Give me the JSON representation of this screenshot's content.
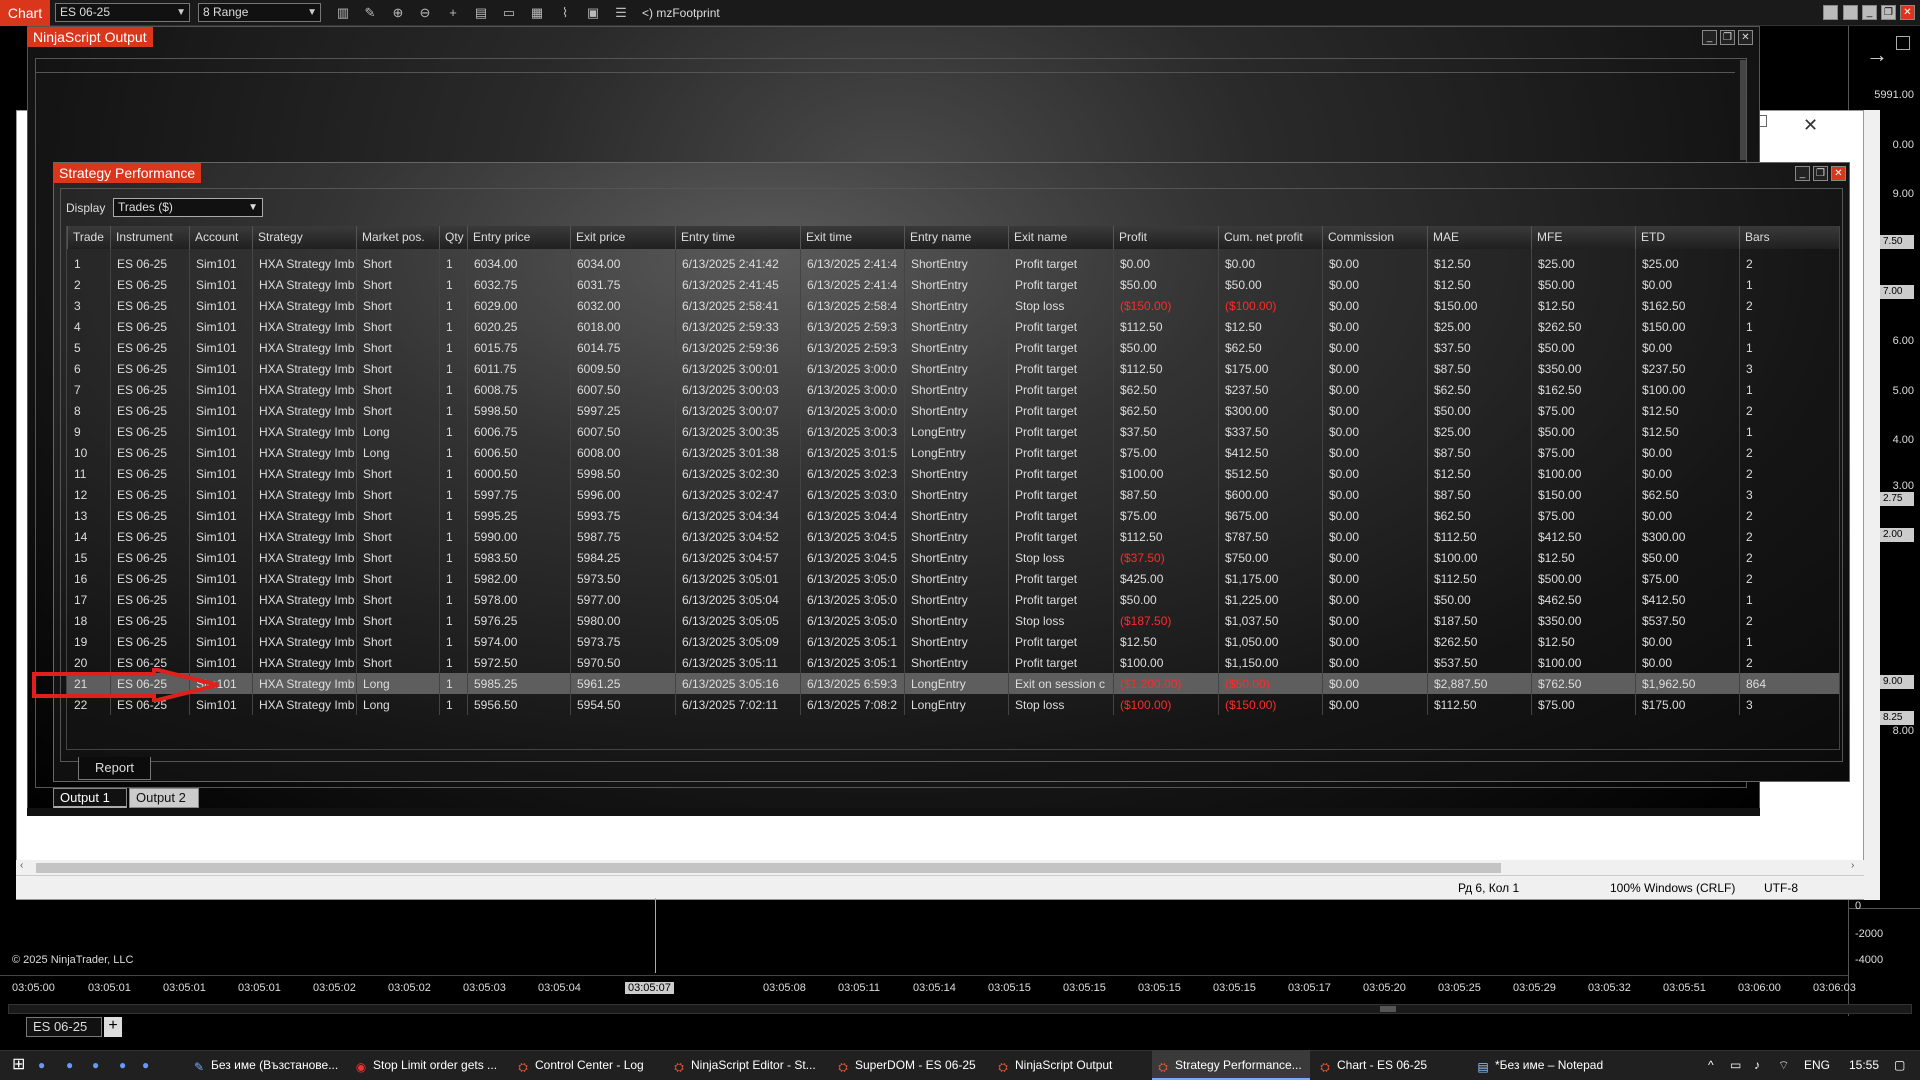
{
  "toolbar": {
    "chart_tab": "Chart",
    "instrument": "ES 06-25",
    "bar_type": "8 Range",
    "indicator_label": "mzFootprint"
  },
  "nso": {
    "title": "NinjaScript Output",
    "tabs": [
      "Output 1",
      "Output 2"
    ]
  },
  "sp": {
    "title": "Strategy Performance",
    "display_label": "Display",
    "display_value": "Trades ($)",
    "report_tab": "Report",
    "columns": [
      "Trade",
      "Instrument",
      "Account",
      "Strategy",
      "Market pos.",
      "Qty",
      "Entry price",
      "Exit price",
      "Entry time",
      "Exit time",
      "Entry name",
      "Exit name",
      "Profit",
      "Cum. net profit",
      "Commission",
      "MAE",
      "MFE",
      "ETD",
      "Bars"
    ],
    "rows": [
      [
        "1",
        "ES 06-25",
        "Sim101",
        "HXA Strategy Imb",
        "Short",
        "1",
        "6034.00",
        "6034.00",
        "6/13/2025 2:41:42",
        "6/13/2025 2:41:4",
        "ShortEntry",
        "Profit target",
        "$0.00",
        "$0.00",
        "$0.00",
        "$12.50",
        "$25.00",
        "$25.00",
        "2"
      ],
      [
        "2",
        "ES 06-25",
        "Sim101",
        "HXA Strategy Imb",
        "Short",
        "1",
        "6032.75",
        "6031.75",
        "6/13/2025 2:41:45",
        "6/13/2025 2:41:4",
        "ShortEntry",
        "Profit target",
        "$50.00",
        "$50.00",
        "$0.00",
        "$12.50",
        "$50.00",
        "$0.00",
        "1"
      ],
      [
        "3",
        "ES 06-25",
        "Sim101",
        "HXA Strategy Imb",
        "Short",
        "1",
        "6029.00",
        "6032.00",
        "6/13/2025 2:58:41",
        "6/13/2025 2:58:4",
        "ShortEntry",
        "Stop loss",
        "($150.00)",
        "($100.00)",
        "$0.00",
        "$150.00",
        "$12.50",
        "$162.50",
        "2"
      ],
      [
        "4",
        "ES 06-25",
        "Sim101",
        "HXA Strategy Imb",
        "Short",
        "1",
        "6020.25",
        "6018.00",
        "6/13/2025 2:59:33",
        "6/13/2025 2:59:3",
        "ShortEntry",
        "Profit target",
        "$112.50",
        "$12.50",
        "$0.00",
        "$25.00",
        "$262.50",
        "$150.00",
        "1"
      ],
      [
        "5",
        "ES 06-25",
        "Sim101",
        "HXA Strategy Imb",
        "Short",
        "1",
        "6015.75",
        "6014.75",
        "6/13/2025 2:59:36",
        "6/13/2025 2:59:3",
        "ShortEntry",
        "Profit target",
        "$50.00",
        "$62.50",
        "$0.00",
        "$37.50",
        "$50.00",
        "$0.00",
        "1"
      ],
      [
        "6",
        "ES 06-25",
        "Sim101",
        "HXA Strategy Imb",
        "Short",
        "1",
        "6011.75",
        "6009.50",
        "6/13/2025 3:00:01",
        "6/13/2025 3:00:0",
        "ShortEntry",
        "Profit target",
        "$112.50",
        "$175.00",
        "$0.00",
        "$87.50",
        "$350.00",
        "$237.50",
        "3"
      ],
      [
        "7",
        "ES 06-25",
        "Sim101",
        "HXA Strategy Imb",
        "Short",
        "1",
        "6008.75",
        "6007.50",
        "6/13/2025 3:00:03",
        "6/13/2025 3:00:0",
        "ShortEntry",
        "Profit target",
        "$62.50",
        "$237.50",
        "$0.00",
        "$62.50",
        "$162.50",
        "$100.00",
        "1"
      ],
      [
        "8",
        "ES 06-25",
        "Sim101",
        "HXA Strategy Imb",
        "Short",
        "1",
        "5998.50",
        "5997.25",
        "6/13/2025 3:00:07",
        "6/13/2025 3:00:0",
        "ShortEntry",
        "Profit target",
        "$62.50",
        "$300.00",
        "$0.00",
        "$50.00",
        "$75.00",
        "$12.50",
        "2"
      ],
      [
        "9",
        "ES 06-25",
        "Sim101",
        "HXA Strategy Imb",
        "Long",
        "1",
        "6006.75",
        "6007.50",
        "6/13/2025 3:00:35",
        "6/13/2025 3:00:3",
        "LongEntry",
        "Profit target",
        "$37.50",
        "$337.50",
        "$0.00",
        "$25.00",
        "$50.00",
        "$12.50",
        "1"
      ],
      [
        "10",
        "ES 06-25",
        "Sim101",
        "HXA Strategy Imb",
        "Long",
        "1",
        "6006.50",
        "6008.00",
        "6/13/2025 3:01:38",
        "6/13/2025 3:01:5",
        "LongEntry",
        "Profit target",
        "$75.00",
        "$412.50",
        "$0.00",
        "$87.50",
        "$75.00",
        "$0.00",
        "2"
      ],
      [
        "11",
        "ES 06-25",
        "Sim101",
        "HXA Strategy Imb",
        "Short",
        "1",
        "6000.50",
        "5998.50",
        "6/13/2025 3:02:30",
        "6/13/2025 3:02:3",
        "ShortEntry",
        "Profit target",
        "$100.00",
        "$512.50",
        "$0.00",
        "$12.50",
        "$100.00",
        "$0.00",
        "2"
      ],
      [
        "12",
        "ES 06-25",
        "Sim101",
        "HXA Strategy Imb",
        "Short",
        "1",
        "5997.75",
        "5996.00",
        "6/13/2025 3:02:47",
        "6/13/2025 3:03:0",
        "ShortEntry",
        "Profit target",
        "$87.50",
        "$600.00",
        "$0.00",
        "$87.50",
        "$150.00",
        "$62.50",
        "3"
      ],
      [
        "13",
        "ES 06-25",
        "Sim101",
        "HXA Strategy Imb",
        "Short",
        "1",
        "5995.25",
        "5993.75",
        "6/13/2025 3:04:34",
        "6/13/2025 3:04:4",
        "ShortEntry",
        "Profit target",
        "$75.00",
        "$675.00",
        "$0.00",
        "$62.50",
        "$75.00",
        "$0.00",
        "2"
      ],
      [
        "14",
        "ES 06-25",
        "Sim101",
        "HXA Strategy Imb",
        "Short",
        "1",
        "5990.00",
        "5987.75",
        "6/13/2025 3:04:52",
        "6/13/2025 3:04:5",
        "ShortEntry",
        "Profit target",
        "$112.50",
        "$787.50",
        "$0.00",
        "$112.50",
        "$412.50",
        "$300.00",
        "2"
      ],
      [
        "15",
        "ES 06-25",
        "Sim101",
        "HXA Strategy Imb",
        "Short",
        "1",
        "5983.50",
        "5984.25",
        "6/13/2025 3:04:57",
        "6/13/2025 3:04:5",
        "ShortEntry",
        "Stop loss",
        "($37.50)",
        "$750.00",
        "$0.00",
        "$100.00",
        "$12.50",
        "$50.00",
        "2"
      ],
      [
        "16",
        "ES 06-25",
        "Sim101",
        "HXA Strategy Imb",
        "Short",
        "1",
        "5982.00",
        "5973.50",
        "6/13/2025 3:05:01",
        "6/13/2025 3:05:0",
        "ShortEntry",
        "Profit target",
        "$425.00",
        "$1,175.00",
        "$0.00",
        "$112.50",
        "$500.00",
        "$75.00",
        "2"
      ],
      [
        "17",
        "ES 06-25",
        "Sim101",
        "HXA Strategy Imb",
        "Short",
        "1",
        "5978.00",
        "5977.00",
        "6/13/2025 3:05:04",
        "6/13/2025 3:05:0",
        "ShortEntry",
        "Profit target",
        "$50.00",
        "$1,225.00",
        "$0.00",
        "$50.00",
        "$462.50",
        "$412.50",
        "1"
      ],
      [
        "18",
        "ES 06-25",
        "Sim101",
        "HXA Strategy Imb",
        "Short",
        "1",
        "5976.25",
        "5980.00",
        "6/13/2025 3:05:05",
        "6/13/2025 3:05:0",
        "ShortEntry",
        "Stop loss",
        "($187.50)",
        "$1,037.50",
        "$0.00",
        "$187.50",
        "$350.00",
        "$537.50",
        "2"
      ],
      [
        "19",
        "ES 06-25",
        "Sim101",
        "HXA Strategy Imb",
        "Short",
        "1",
        "5974.00",
        "5973.75",
        "6/13/2025 3:05:09",
        "6/13/2025 3:05:1",
        "ShortEntry",
        "Profit target",
        "$12.50",
        "$1,050.00",
        "$0.00",
        "$262.50",
        "$12.50",
        "$0.00",
        "1"
      ],
      [
        "20",
        "ES 06-25",
        "Sim101",
        "HXA Strategy Imb",
        "Short",
        "1",
        "5972.50",
        "5970.50",
        "6/13/2025 3:05:11",
        "6/13/2025 3:05:1",
        "ShortEntry",
        "Profit target",
        "$100.00",
        "$1,150.00",
        "$0.00",
        "$537.50",
        "$100.00",
        "$0.00",
        "2"
      ],
      [
        "21",
        "ES 06-25",
        "Sim101",
        "HXA Strategy Imb",
        "Long",
        "1",
        "5985.25",
        "5961.25",
        "6/13/2025 3:05:16",
        "6/13/2025 6:59:3",
        "LongEntry",
        "Exit on session c",
        "($1,200.00)",
        "($50.00)",
        "$0.00",
        "$2,887.50",
        "$762.50",
        "$1,962.50",
        "864"
      ],
      [
        "22",
        "ES 06-25",
        "Sim101",
        "HXA Strategy Imb",
        "Long",
        "1",
        "5956.50",
        "5954.50",
        "6/13/2025 7:02:11",
        "6/13/2025 7:08:2",
        "LongEntry",
        "Stop loss",
        "($100.00)",
        "($150.00)",
        "$0.00",
        "$112.50",
        "$75.00",
        "$175.00",
        "3"
      ]
    ]
  },
  "notepad": {
    "position": "Рд 6, Кол 1",
    "zoom": "100%",
    "line_endings": "Windows (CRLF)",
    "encoding": "UTF-8"
  },
  "chart": {
    "prices": [
      "5991.00",
      "0.00",
      "9.00",
      "7.50",
      "7.00",
      "6.00",
      "5.00",
      "4.00",
      "3.00",
      "2.75",
      "2.00",
      "9.00",
      "8.25",
      "8.00",
      "0",
      "-2000",
      "-4000"
    ],
    "copyright": "© 2025 NinjaTrader, LLC",
    "time_labels": [
      "03:05:00",
      "03:05:01",
      "03:05:01",
      "03:05:01",
      "03:05:02",
      "03:05:02",
      "03:05:03",
      "03:05:04",
      "03:05:07",
      "03:05:07",
      "03:05:08",
      "03:05:11",
      "03:05:14",
      "03:05:15",
      "03:05:15",
      "03:05:15",
      "03:05:15",
      "03:05:17",
      "03:05:20",
      "03:05:25",
      "03:05:29",
      "03:05:32",
      "03:05:51",
      "03:06:00",
      "03:06:03"
    ],
    "bottom_tab": "ES 06-25"
  },
  "taskbar": {
    "items": [
      "Без име (Възстанове...",
      "Stop Limit order gets ...",
      "Control Center - Log",
      "NinjaScript Editor - St...",
      "SuperDOM - ES 06-25",
      "NinjaScript Output",
      "Strategy Performance...",
      "Chart - ES 06-25",
      "*Без име – Notepad"
    ],
    "lang": "ENG",
    "clock": "15:55"
  },
  "colors": {
    "accent": "#d9361b",
    "negative": "#ff2a2a",
    "highlight_row": "#5e5e5e",
    "annotation_arrow": "#e0201b"
  }
}
